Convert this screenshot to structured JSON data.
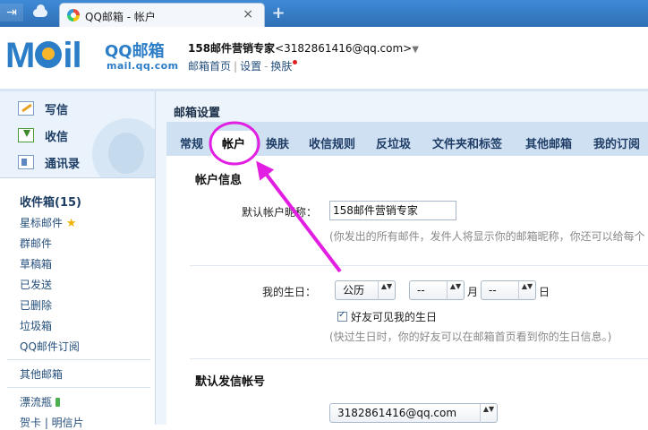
{
  "browser": {
    "tab_title": "QQ邮箱 - 帐户",
    "close_glyph": "×",
    "new_tab_glyph": "+"
  },
  "header": {
    "logo_text": "MOil",
    "logo_name": "QQ邮箱",
    "logo_domain": "mail.qq.com",
    "nickname": "158邮件营销专家",
    "email": "<3182861416@qq.com>",
    "caret": "▼",
    "links": [
      "邮箱首页",
      "设置",
      "换肤"
    ]
  },
  "sidebar": {
    "quick_actions": [
      {
        "label": "写信",
        "icon": "write-icon"
      },
      {
        "label": "收信",
        "icon": "inbox-download-icon"
      },
      {
        "label": "通讯录",
        "icon": "address-book-icon"
      }
    ],
    "folders": [
      {
        "label": "收件箱(15)",
        "bold": true
      },
      {
        "label": "星标邮件",
        "icon": "star-icon"
      },
      {
        "label": "群邮件"
      },
      {
        "label": "草稿箱"
      },
      {
        "label": "已发送"
      },
      {
        "label": "已删除"
      },
      {
        "label": "垃圾箱"
      },
      {
        "label": "QQ邮件订阅"
      }
    ],
    "other_mailbox": "其他邮箱",
    "drift_bottle": "漂流瓶",
    "cards": "贺卡 | 明信片"
  },
  "main": {
    "title": "邮箱设置",
    "tabs": [
      "常规",
      "帐户",
      "换肤",
      "收信规则",
      "反垃圾",
      "文件夹和标签",
      "其他邮箱",
      "我的订阅"
    ],
    "active_tab": "帐户",
    "account_section": {
      "title": "帐户信息",
      "nickname_label": "默认帐户昵称：",
      "nickname_value": "158邮件营销专家",
      "nickname_hint": "(你发出的所有邮件，发件人将显示你的邮箱昵称，你还可以给每个",
      "birthday_label": "我的生日：",
      "calendar_value": "公历",
      "month_value": "--",
      "month_unit": "月",
      "day_value": "--",
      "day_unit": "日",
      "friends_checkbox_label": "好友可见我的生日",
      "friends_checkbox_checked": true,
      "birthday_hint": "(快过生日时，你的好友可以在邮箱首页看到你的生日信息。)"
    },
    "sender_section": {
      "title": "默认发信帐号",
      "sender_value": "3182861416@qq.com"
    }
  },
  "colors": {
    "brand_blue": "#2c7dc7",
    "annotation_magenta": "#e11ee1"
  }
}
